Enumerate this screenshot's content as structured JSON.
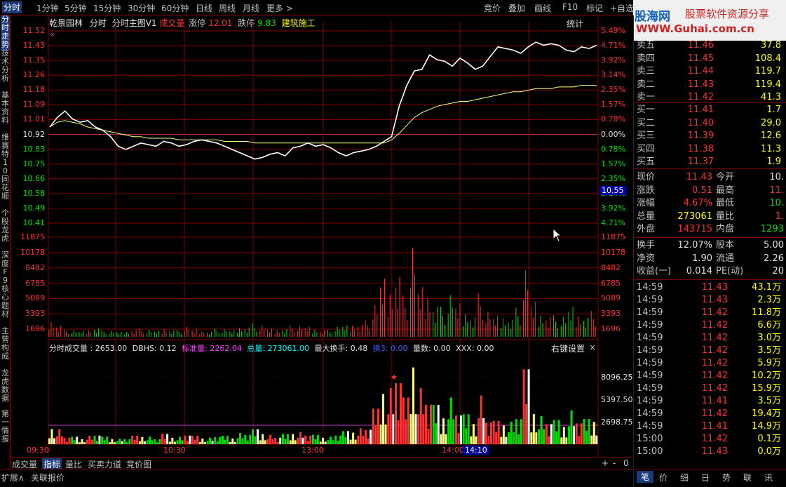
{
  "toolbar": {
    "tabs": [
      "分时",
      "1分钟",
      "5分钟",
      "15分钟",
      "30分钟",
      "60分钟",
      "日线",
      "周线",
      "月线",
      "更多 >"
    ],
    "right_tabs": [
      "竞价",
      "叠加",
      "画线",
      "F10",
      "标记",
      "+自选"
    ]
  },
  "logo": {
    "line1": "股海网",
    "line1b": "股票软件资源分享",
    "line2": "WWW.Guhai.com.cn"
  },
  "left_tabs": [
    "分时走势",
    "技术分析",
    "基本资料",
    "维赛特10",
    "同花顺",
    "个股龙虎",
    "深度F9",
    "核心题材",
    "主营构成",
    "龙虎数据",
    "第一",
    "情报"
  ],
  "header": {
    "stock": "乾景园林",
    "mode": "分时",
    "indicator": "分时主图V1",
    "vol": "成交量",
    "up_label": "涨停",
    "up_val": "12.01",
    "down_label": "跌停",
    "down_val": "9.83",
    "sector": "建筑施工",
    "stats": "统计"
  },
  "price_axis_left": [
    "11.52",
    "11.43",
    "11.35",
    "11.26",
    "11.18",
    "11.09",
    "11.01",
    "10.92",
    "10.83",
    "10.75",
    "10.66",
    "10.58",
    "10.49",
    "10.41"
  ],
  "pct_axis_right": [
    "5.49%",
    "4.71%",
    "3.92%",
    "3.14%",
    "2.35%",
    "1.57%",
    "0.78%",
    "0.00%",
    "0.78%",
    "1.57%",
    "2.35%",
    "3.14%",
    "3.92%",
    "4.71%"
  ],
  "cursor_price": "10.55",
  "vol_axis": [
    "11875",
    "10178",
    "8482",
    "6785",
    "5089",
    "3393",
    "1696"
  ],
  "sub_header": {
    "name": "分时成交量 : 2653.00",
    "dbhs": "DBHS: 0.12",
    "std": "标准量: 2262.04",
    "total": "总量: 273061.00",
    "maxturn": "最大换手: 0.48",
    "huan3": "换3: 0.00",
    "count": "量数: 0.00",
    "xxx": "XXX: 0.00",
    "settings": "右键设置",
    "close": "×"
  },
  "sub_axis": [
    "8096.25",
    "5397.50",
    "2698.75"
  ],
  "time_axis": [
    "09:30",
    "10:30",
    "13:00",
    "14:00"
  ],
  "cursor_time": "14:10",
  "bottom_tabs": [
    "成交量",
    "指标",
    "量比",
    "买卖力道",
    "竞价图"
  ],
  "bottom_icons": [
    "+",
    "-",
    "0"
  ],
  "bottom_bar": [
    "扩展∧",
    "关联报价"
  ],
  "right_bottom_tabs": [
    "笔",
    "价",
    "细",
    "日",
    "势",
    "联",
    "讯"
  ],
  "orderbook": {
    "sell": [
      {
        "label": "卖五",
        "price": "11.46",
        "vol": "37.8"
      },
      {
        "label": "卖四",
        "price": "11.45",
        "vol": "108.4"
      },
      {
        "label": "卖三",
        "price": "11.44",
        "vol": "119.7"
      },
      {
        "label": "卖二",
        "price": "11.43",
        "vol": "119.4"
      },
      {
        "label": "卖一",
        "price": "11.42",
        "vol": "41.3"
      }
    ],
    "buy": [
      {
        "label": "买一",
        "price": "11.41",
        "vol": "1.7"
      },
      {
        "label": "买二",
        "price": "11.40",
        "vol": "29.0"
      },
      {
        "label": "买三",
        "price": "11.39",
        "vol": "12.6"
      },
      {
        "label": "买四",
        "price": "11.38",
        "vol": "11.3"
      },
      {
        "label": "买五",
        "price": "11.37",
        "vol": "1.9"
      }
    ]
  },
  "quote": [
    {
      "l1": "现价",
      "v1": "11.43",
      "l2": "今开",
      "v2": "10."
    },
    {
      "l1": "涨跌",
      "v1": "0.51",
      "l2": "最高",
      "v2": "11."
    },
    {
      "l1": "涨幅",
      "v1": "4.67%",
      "l2": "最低",
      "v2": "10."
    },
    {
      "l1": "总量",
      "v1": "273061",
      "l2": "量比",
      "v2": "1."
    },
    {
      "l1": "外盘",
      "v1": "143715",
      "l2": "内盘",
      "v2": "1293"
    }
  ],
  "fund": [
    {
      "l1": "换手",
      "v1": "12.07%",
      "l2": "股本",
      "v2": "5.00"
    },
    {
      "l1": "净资",
      "v1": "1.90",
      "l2": "流通",
      "v2": "2.26"
    },
    {
      "l1": "收益(一)",
      "v1": "0.014",
      "l2": "PE(动)",
      "v2": "20"
    }
  ],
  "ticks": [
    {
      "t": "14:59",
      "p": "11.43",
      "v": "43.1万"
    },
    {
      "t": "14:59",
      "p": "11.43",
      "v": "2.3万"
    },
    {
      "t": "14:59",
      "p": "11.42",
      "v": "11.8万"
    },
    {
      "t": "14:59",
      "p": "11.42",
      "v": "6.6万"
    },
    {
      "t": "14:59",
      "p": "11.42",
      "v": "3.0万"
    },
    {
      "t": "14:59",
      "p": "11.42",
      "v": "3.5万"
    },
    {
      "t": "14:59",
      "p": "11.42",
      "v": "5.9万"
    },
    {
      "t": "14:59",
      "p": "11.42",
      "v": "10.2万"
    },
    {
      "t": "14:59",
      "p": "11.42",
      "v": "15.9万"
    },
    {
      "t": "14:59",
      "p": "11.41",
      "v": "3.5万"
    },
    {
      "t": "14:59",
      "p": "11.42",
      "v": "19.4万"
    },
    {
      "t": "14:59",
      "p": "11.41",
      "v": "14.9万"
    },
    {
      "t": "15:00",
      "p": "11.42",
      "v": "0.1万"
    },
    {
      "t": "15:00",
      "p": "11.43",
      "v": "0.0万"
    }
  ],
  "colors": {
    "up": "#ff3232",
    "down": "#00e000",
    "grid": "#800000",
    "price_line": "#ffffff",
    "avg_line": "#ffff80"
  },
  "chart_data": {
    "type": "line",
    "prev_close": 10.92,
    "x_labels": [
      "09:30",
      "10:30",
      "13:00",
      "14:00"
    ],
    "ylim": [
      10.32,
      11.52
    ],
    "series": [
      {
        "values": [
          10.92,
          10.98,
          11.02,
          10.97,
          10.95,
          10.96,
          10.92,
          10.9,
          10.86,
          10.8,
          10.78,
          10.8,
          10.82,
          10.81,
          10.8,
          10.83,
          10.82,
          10.8,
          10.81,
          10.83,
          10.84,
          10.83,
          10.82,
          10.8,
          10.78,
          10.76,
          10.74,
          10.72,
          10.73,
          10.75,
          10.76,
          10.74,
          10.79,
          10.8,
          10.82,
          10.8,
          10.81,
          10.79,
          10.76,
          10.74,
          10.76,
          10.77,
          10.78,
          10.8,
          10.83,
          10.86,
          11.05,
          11.18,
          11.27,
          11.28,
          11.37,
          11.34,
          11.33,
          11.3,
          11.35,
          11.32,
          11.28,
          11.3,
          11.36,
          11.42,
          11.41,
          11.4,
          11.38,
          11.42,
          11.45,
          11.43,
          11.44,
          11.43,
          11.4,
          11.39,
          11.42,
          11.41,
          11.43
        ]
      },
      {
        "values": [
          10.92,
          10.95,
          10.96,
          10.95,
          10.94,
          10.92,
          10.91,
          10.9,
          10.89,
          10.88,
          10.87,
          10.86,
          10.86,
          10.85,
          10.85,
          10.85,
          10.85,
          10.84,
          10.84,
          10.84,
          10.84,
          10.84,
          10.84,
          10.83,
          10.83,
          10.83,
          10.83,
          10.82,
          10.82,
          10.82,
          10.82,
          10.82,
          10.82,
          10.82,
          10.82,
          10.82,
          10.82,
          10.82,
          10.82,
          10.82,
          10.82,
          10.82,
          10.82,
          10.82,
          10.82,
          10.84,
          10.88,
          10.93,
          10.98,
          11.01,
          11.03,
          11.05,
          11.06,
          11.07,
          11.08,
          11.08,
          11.09,
          11.1,
          11.11,
          11.12,
          11.13,
          11.14,
          11.14,
          11.15,
          11.16,
          11.16,
          11.16,
          11.17,
          11.17,
          11.17,
          11.18,
          11.18,
          11.18
        ]
      }
    ],
    "volume": [
      2100,
      1600,
      900,
      800,
      700,
      900,
      1200,
      800,
      700,
      600,
      700,
      900,
      1000,
      800,
      700,
      1100,
      900,
      800,
      1200,
      900,
      800,
      700,
      1000,
      900,
      800,
      1200,
      1300,
      1600,
      1400,
      1000,
      900,
      1100,
      1400,
      1300,
      1200,
      1000,
      900,
      800,
      1200,
      1400,
      1600,
      1700,
      2000,
      3800,
      7000,
      6000,
      8500,
      5000,
      10700,
      6000,
      5500,
      4200,
      3600,
      5000,
      4000,
      3200,
      2800,
      5200,
      3000,
      2500,
      2600,
      2400,
      3500,
      8000,
      4200,
      3000,
      2800,
      2600,
      2400,
      3600,
      2900,
      2700,
      3100
    ]
  }
}
